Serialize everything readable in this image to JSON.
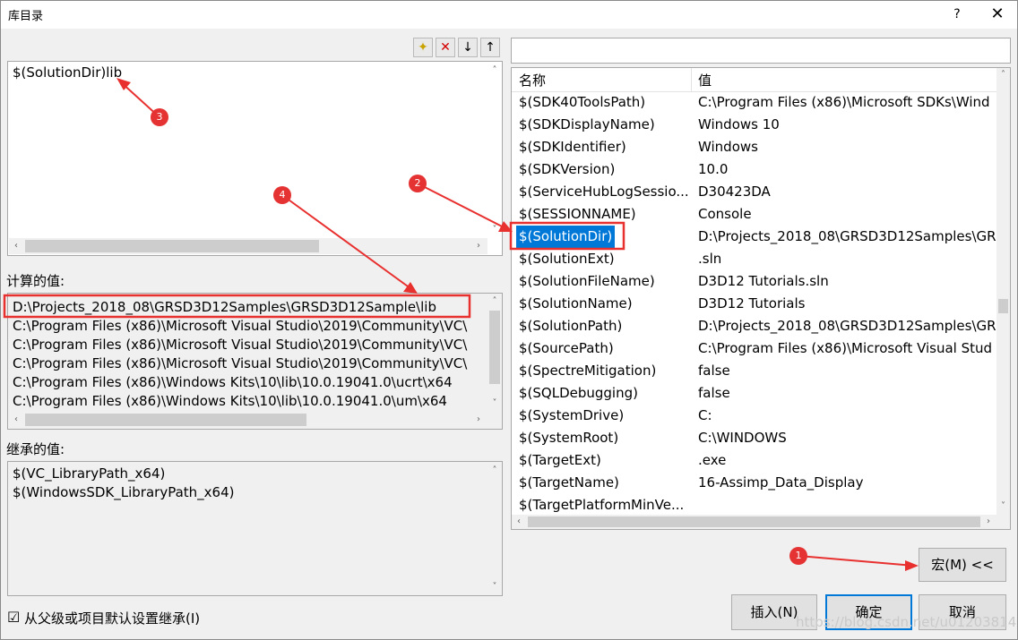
{
  "window": {
    "title": "库目录",
    "help": "?",
    "close": "✕"
  },
  "toolbar": {
    "new_line": "✦",
    "delete": "✕",
    "move_down": "↓",
    "move_up": "↑"
  },
  "editor": {
    "text": "$(SolutionDir)lib"
  },
  "evaluated": {
    "label": "计算的值:",
    "lines": [
      "D:\\Projects_2018_08\\GRSD3D12Samples\\GRSD3D12Sample\\lib",
      "C:\\Program Files (x86)\\Microsoft Visual Studio\\2019\\Community\\VC\\",
      "C:\\Program Files (x86)\\Microsoft Visual Studio\\2019\\Community\\VC\\",
      "C:\\Program Files (x86)\\Microsoft Visual Studio\\2019\\Community\\VC\\",
      "C:\\Program Files (x86)\\Windows Kits\\10\\lib\\10.0.19041.0\\ucrt\\x64",
      "C:\\Program Files (x86)\\Windows Kits\\10\\lib\\10.0.19041.0\\um\\x64"
    ]
  },
  "inherited": {
    "label": "继承的值:",
    "lines": [
      "$(VC_LibraryPath_x64)",
      "$(WindowsSDK_LibraryPath_x64)"
    ]
  },
  "inherit_checkbox": {
    "checked": "☑",
    "label": "从父级或项目默认设置继承(I)"
  },
  "macros": {
    "search_value": "",
    "col_name": "名称",
    "col_value": "值",
    "rows": [
      {
        "name": "$(SDK40ToolsPath)",
        "value": "C:\\Program Files (x86)\\Microsoft SDKs\\Wind"
      },
      {
        "name": "$(SDKDisplayName)",
        "value": "Windows 10"
      },
      {
        "name": "$(SDKIdentifier)",
        "value": "Windows"
      },
      {
        "name": "$(SDKVersion)",
        "value": "10.0"
      },
      {
        "name": "$(ServiceHubLogSessio...",
        "value": "D30423DA"
      },
      {
        "name": "$(SESSIONNAME)",
        "value": "Console"
      },
      {
        "name": "$(SolutionDir)",
        "value": "D:\\Projects_2018_08\\GRSD3D12Samples\\GR"
      },
      {
        "name": "$(SolutionExt)",
        "value": ".sln"
      },
      {
        "name": "$(SolutionFileName)",
        "value": "D3D12 Tutorials.sln"
      },
      {
        "name": "$(SolutionName)",
        "value": "D3D12 Tutorials"
      },
      {
        "name": "$(SolutionPath)",
        "value": "D:\\Projects_2018_08\\GRSD3D12Samples\\GR"
      },
      {
        "name": "$(SourcePath)",
        "value": "C:\\Program Files (x86)\\Microsoft Visual Stud"
      },
      {
        "name": "$(SpectreMitigation)",
        "value": "false"
      },
      {
        "name": "$(SQLDebugging)",
        "value": "false"
      },
      {
        "name": "$(SystemDrive)",
        "value": "C:"
      },
      {
        "name": "$(SystemRoot)",
        "value": "C:\\WINDOWS"
      },
      {
        "name": "$(TargetExt)",
        "value": ".exe"
      },
      {
        "name": "$(TargetName)",
        "value": "16-Assimp_Data_Display"
      },
      {
        "name": "$(TargetPlatformMinVe...",
        "value": ""
      }
    ]
  },
  "buttons": {
    "macro": "宏(M) <<",
    "insert": "插入(N)",
    "ok": "确定",
    "cancel": "取消"
  },
  "annotations": {
    "b1": "1",
    "b2": "2",
    "b3": "3",
    "b4": "4"
  },
  "watermark": "https://blog.csdn.net/u012038143",
  "colors": {
    "selection": "#0078d7",
    "annotation_red": "#e8302f"
  }
}
